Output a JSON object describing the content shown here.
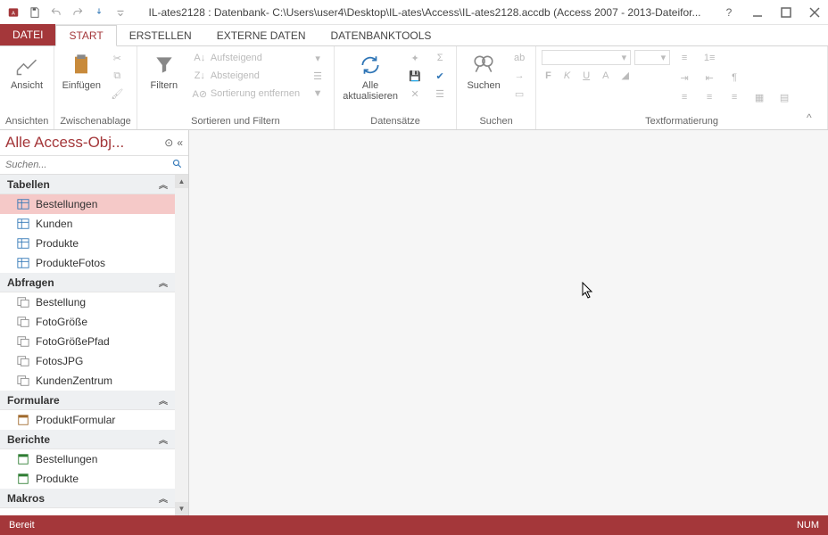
{
  "titlebar": {
    "title": "IL-ates2128 : Datenbank- C:\\Users\\user4\\Desktop\\IL-ates\\Access\\IL-ates2128.accdb (Access 2007 - 2013-Dateifor..."
  },
  "tabs": {
    "file": "DATEI",
    "start": "START",
    "erstellen": "ERSTELLEN",
    "externe": "EXTERNE DATEN",
    "tools": "DATENBANKTOOLS"
  },
  "ribbon": {
    "ansicht": "Ansicht",
    "einfuegen": "Einfügen",
    "filtern": "Filtern",
    "aufsteigend": "Aufsteigend",
    "absteigend": "Absteigend",
    "sortierung_entfernen": "Sortierung entfernen",
    "alle_aktualisieren": "Alle\naktualisieren",
    "suchen": "Suchen",
    "groups": {
      "ansichten": "Ansichten",
      "zwischenablage": "Zwischenablage",
      "sortieren": "Sortieren und Filtern",
      "datensaetze": "Datensätze",
      "suchen": "Suchen",
      "textformatierung": "Textformatierung"
    }
  },
  "nav": {
    "title": "Alle Access-Obj...",
    "search_placeholder": "Suchen...",
    "cat_tabellen": "Tabellen",
    "cat_abfragen": "Abfragen",
    "cat_formulare": "Formulare",
    "cat_berichte": "Berichte",
    "cat_makros": "Makros",
    "tables": [
      "Bestellungen",
      "Kunden",
      "Produkte",
      "ProdukteFotos"
    ],
    "queries": [
      "Bestellung",
      "FotoGröße",
      "FotoGrößePfad",
      "FotosJPG",
      "KundenZentrum"
    ],
    "forms": [
      "ProduktFormular"
    ],
    "reports": [
      "Bestellungen",
      "Produkte"
    ]
  },
  "status": {
    "left": "Bereit",
    "right": "NUM"
  }
}
